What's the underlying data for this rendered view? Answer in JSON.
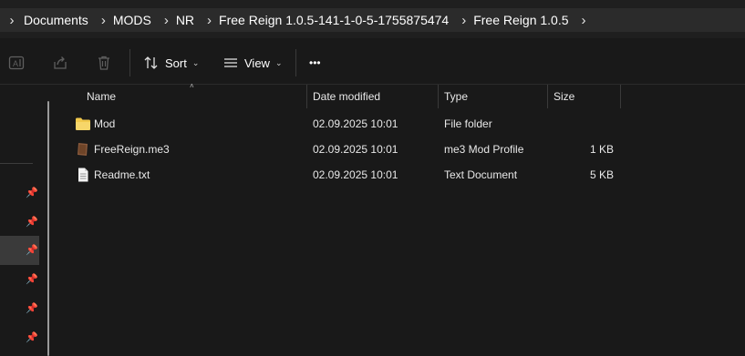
{
  "breadcrumb": [
    "Documents",
    "MODS",
    "NR",
    "Free Reign 1.0.5-141-1-0-5-1755875474",
    "Free Reign 1.0.5"
  ],
  "toolbar": {
    "sort_label": "Sort",
    "view_label": "View",
    "more_label": "•••"
  },
  "columns": {
    "name": "Name",
    "date": "Date modified",
    "type": "Type",
    "size": "Size"
  },
  "files": [
    {
      "name": "Mod",
      "date": "02.09.2025 10:01",
      "type": "File folder",
      "size": "",
      "icon": "folder-icon"
    },
    {
      "name": "FreeReign.me3",
      "date": "02.09.2025 10:01",
      "type": "me3 Mod Profile",
      "size": "1 KB",
      "icon": "mod-profile-icon"
    },
    {
      "name": "Readme.txt",
      "date": "02.09.2025 10:01",
      "type": "Text Document",
      "size": "5 KB",
      "icon": "text-file-icon"
    }
  ],
  "colors": {
    "background": "#191919",
    "breadcrumb_bg": "#2b2b2b",
    "folder": "#f2c94c",
    "selected_nav": "#3a3a3a"
  }
}
